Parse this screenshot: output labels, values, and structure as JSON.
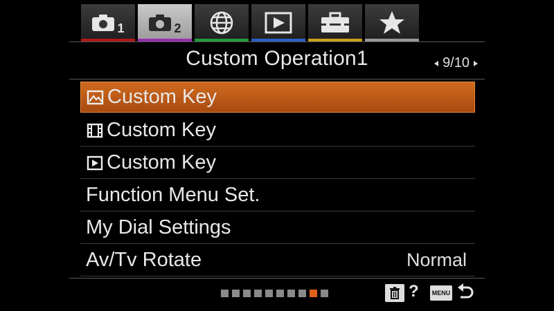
{
  "tabs": [
    {
      "name": "camera-1",
      "num": "1",
      "stripe": "#b01818",
      "active": false
    },
    {
      "name": "camera-2",
      "num": "2",
      "stripe": "#9a2fb0",
      "active": true
    },
    {
      "name": "network",
      "num": "",
      "stripe": "#1f9c3a",
      "active": false
    },
    {
      "name": "playback",
      "num": "",
      "stripe": "#2a5fc8",
      "active": false
    },
    {
      "name": "setup",
      "num": "",
      "stripe": "#c8a018",
      "active": false
    },
    {
      "name": "my-menu",
      "num": "",
      "stripe": "#9a9a9a",
      "active": false
    }
  ],
  "header": {
    "title": "Custom Operation1",
    "page": "9/10"
  },
  "menu": {
    "items": [
      {
        "label": "Custom Key",
        "icon": "still-image-icon",
        "value": ""
      },
      {
        "label": "Custom Key",
        "icon": "movie-film-icon",
        "value": ""
      },
      {
        "label": "Custom Key",
        "icon": "playback-icon",
        "value": ""
      },
      {
        "label": "Function Menu Set.",
        "icon": "",
        "value": ""
      },
      {
        "label": "My Dial Settings",
        "icon": "",
        "value": ""
      },
      {
        "label": "Av/Tv Rotate",
        "icon": "",
        "value": "Normal"
      }
    ],
    "selected_index": 0
  },
  "pager": {
    "total": 10,
    "current": 9
  },
  "footer": {
    "help_label": "?",
    "menu_label": "MENU"
  },
  "colors": {
    "selection": "#c45a18",
    "accent_dot": "#e0601a"
  }
}
